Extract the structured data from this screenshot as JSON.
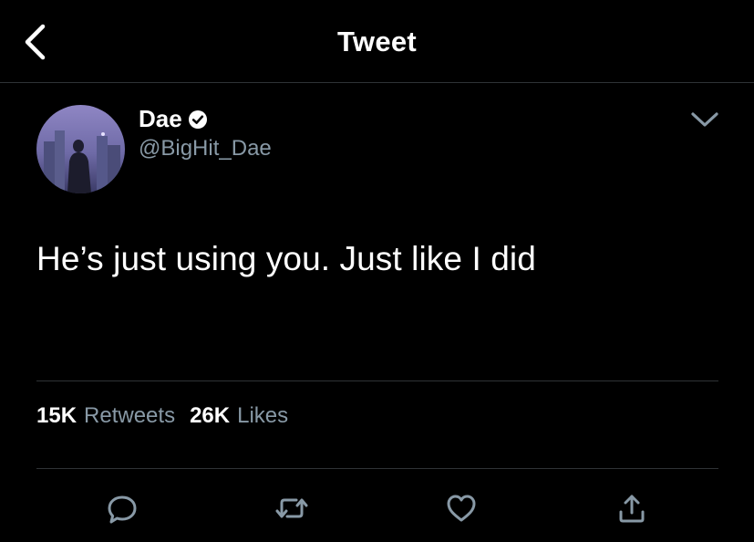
{
  "header": {
    "title": "Tweet",
    "back_icon": "chevron-left-icon"
  },
  "tweet": {
    "display_name": "Dae",
    "handle": "@BigHit_Dae",
    "verified_icon": "verified-badge-icon",
    "menu_icon": "chevron-down-icon",
    "text": "He’s just using you. Just like I did",
    "retweets_count": "15K",
    "retweets_label": "Retweets",
    "likes_count": "26K",
    "likes_label": "Likes"
  },
  "actions": [
    {
      "icon": "reply-icon"
    },
    {
      "icon": "retweet-icon"
    },
    {
      "icon": "like-icon"
    },
    {
      "icon": "share-icon"
    }
  ],
  "colors": {
    "background": "#000000",
    "text": "#ffffff",
    "secondary_text": "#8899a6",
    "divider": "#2f3336"
  }
}
